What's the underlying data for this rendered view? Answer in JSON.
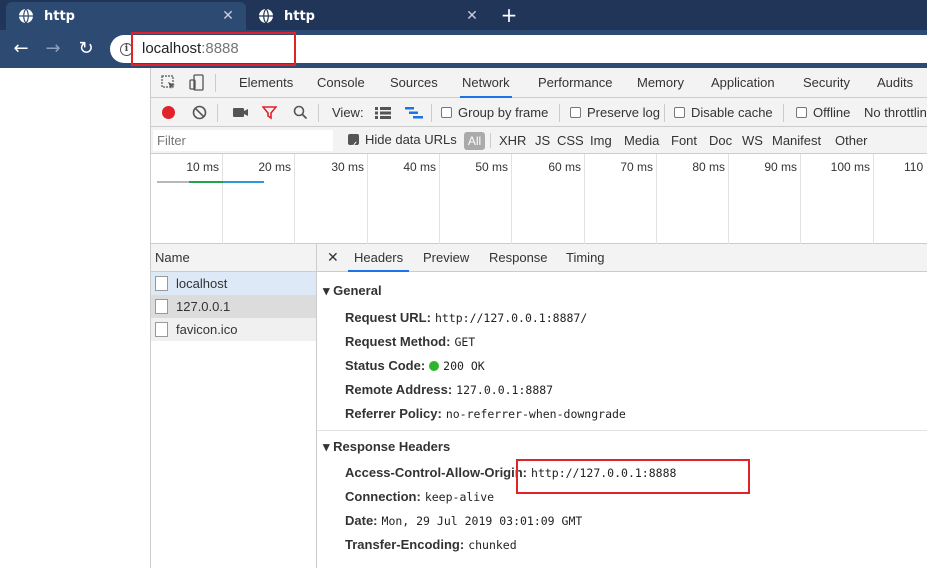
{
  "browser": {
    "tabs": [
      {
        "label": "http",
        "close": "✕",
        "active": true
      },
      {
        "label": "http",
        "close": "✕",
        "active": false
      }
    ],
    "new_tab": "+",
    "nav": {
      "back": "←",
      "forward": "→",
      "reload": "↻"
    },
    "info_icon": "i",
    "url_host": "localhost",
    "url_port": ":8888"
  },
  "devtools": {
    "tabs": [
      "Elements",
      "Console",
      "Sources",
      "Network",
      "Performance",
      "Memory",
      "Application",
      "Security",
      "Audits"
    ],
    "active_tab": "Network",
    "toolbar": {
      "view_label": "View:",
      "group_by_frame": "Group by frame",
      "preserve_log": "Preserve log",
      "disable_cache": "Disable cache",
      "offline": "Offline",
      "throttling": "No throttlin"
    },
    "filter": {
      "placeholder": "Filter",
      "hide_data_urls": "Hide data URLs",
      "types": [
        "All",
        "XHR",
        "JS",
        "CSS",
        "Img",
        "Media",
        "Font",
        "Doc",
        "WS",
        "Manifest",
        "Other"
      ]
    },
    "timeline_ticks": [
      "10 ms",
      "20 ms",
      "30 ms",
      "40 ms",
      "50 ms",
      "60 ms",
      "70 ms",
      "80 ms",
      "90 ms",
      "100 ms",
      "110"
    ],
    "requests": {
      "header": "Name",
      "rows": [
        "localhost",
        "127.0.0.1",
        "favicon.ico"
      ]
    },
    "headers_pane": {
      "close": "✕",
      "tabs": [
        "Headers",
        "Preview",
        "Response",
        "Timing"
      ],
      "active_tab": "Headers",
      "general_title": "General",
      "general": [
        {
          "key": "Request URL:",
          "value": "http://127.0.0.1:8887/"
        },
        {
          "key": "Request Method:",
          "value": "GET"
        },
        {
          "key": "Status Code:",
          "value": "200 OK"
        },
        {
          "key": "Remote Address:",
          "value": "127.0.0.1:8887"
        },
        {
          "key": "Referrer Policy:",
          "value": "no-referrer-when-downgrade"
        }
      ],
      "response_title": "Response Headers",
      "response": [
        {
          "key": "Access-Control-Allow-Origin:",
          "value": "http://127.0.0.1:8888"
        },
        {
          "key": "Connection:",
          "value": "keep-alive"
        },
        {
          "key": "Date:",
          "value": "Mon, 29 Jul 2019 03:01:09 GMT"
        },
        {
          "key": "Transfer-Encoding:",
          "value": "chunked"
        }
      ]
    }
  },
  "colors": {
    "tabstrip": "#203558",
    "toolbar": "#2d4a73",
    "highlight_box": "#e0222a",
    "record": "#e0222a",
    "filter_icon": "#e0222a",
    "status_ok": "#2db52d",
    "active_tab_underline": "#1a73e8"
  }
}
